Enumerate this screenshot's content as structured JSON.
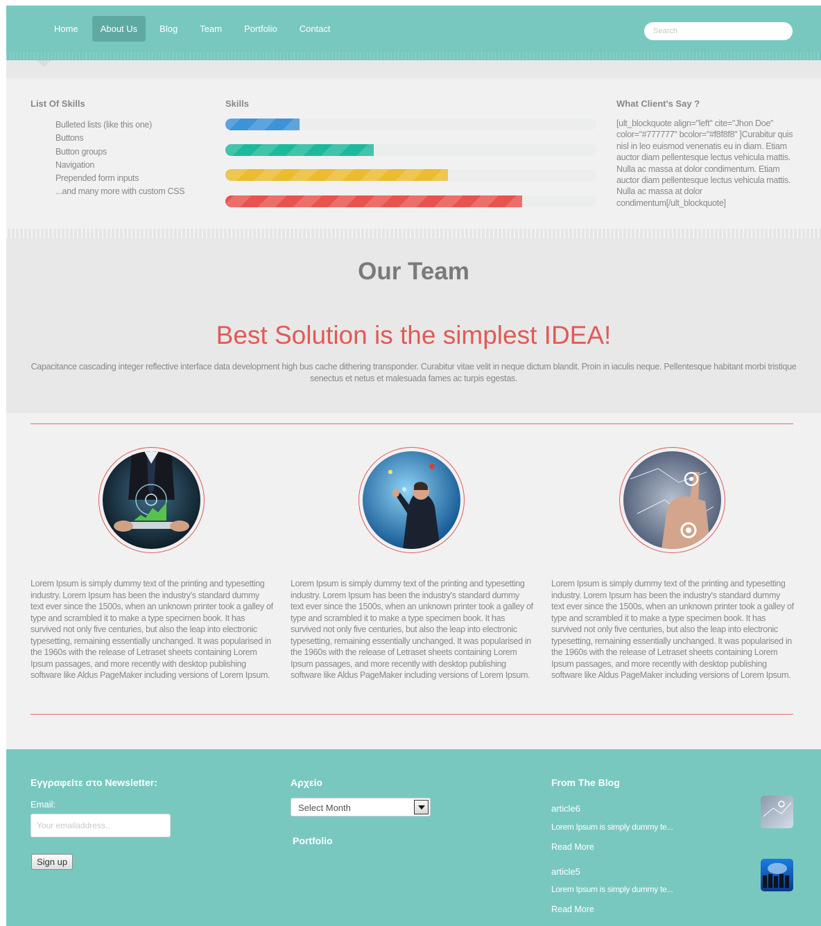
{
  "nav": {
    "items": [
      {
        "label": "Home",
        "active": false
      },
      {
        "label": "About Us",
        "active": true
      },
      {
        "label": "Blog",
        "active": false
      },
      {
        "label": "Team",
        "active": false
      },
      {
        "label": "Portfolio",
        "active": false
      },
      {
        "label": "Contact",
        "active": false
      }
    ],
    "search_placeholder": "Search"
  },
  "skills_list": {
    "heading": "List Of Skills",
    "items": [
      "Bulleted lists (like this one)",
      "Buttons",
      "Button groups",
      "Navigation",
      "Prepended form inputs",
      "...and many more with custom CSS"
    ]
  },
  "skills": {
    "heading": "Skills",
    "bars": [
      {
        "level": 0.2,
        "color": "#3c93d8"
      },
      {
        "level": 0.4,
        "color": "#1db99a"
      },
      {
        "level": 0.6,
        "color": "#ebbc2f"
      },
      {
        "level": 0.8,
        "color": "#e8534e"
      }
    ]
  },
  "clients": {
    "heading": "What Client's Say ?",
    "quote": "[ult_blockquote align=\"left\" cite=\"Jhon Doe\" color=\"#777777\" bcolor=\"#f8f8f8\" ]Curabitur quis nisl in leo euismod venenatis eu in diam. Etiam auctor diam pellentesque lectus vehicula mattis. Nulla ac massa at dolor condimentum. Etiam auctor diam pellentesque lectus vehicula mattis. Nulla ac massa at dolor condimentum[/ult_blockquote]"
  },
  "team": {
    "title": "Our Team",
    "headline": "Best Solution is the simplest IDEA!",
    "description": "Capacitance cascading integer reflective interface data development high bus cache dithering transponder. Curabitur vitae velit in neque dictum blandit. Proin in iaculis neque. Pellentesque habitant morbi tristique senectus et netus et malesuada fames ac turpis egestas.",
    "members": [
      {
        "bio": "Lorem Ipsum is simply dummy text of the printing and typesetting industry. Lorem Ipsum has been the industry's standard dummy text ever since the 1500s, when an unknown printer took a galley of type and scrambled it to make a type specimen book. It has survived not only five centuries, but also the leap into electronic typesetting, remaining essentially unchanged. It was popularised in the 1960s with the release of Letraset sheets containing Lorem Ipsum passages, and more recently with desktop publishing software like Aldus PageMaker including versions of Lorem Ipsum."
      },
      {
        "bio": "Lorem Ipsum is simply dummy text of the printing and typesetting industry. Lorem Ipsum has been the industry's standard dummy text ever since the 1500s, when an unknown printer took a galley of type and scrambled it to make a type specimen book. It has survived not only five centuries, but also the leap into electronic typesetting, remaining essentially unchanged. It was popularised in the 1960s with the release of Letraset sheets containing Lorem Ipsum passages, and more recently with desktop publishing software like Aldus PageMaker including versions of Lorem Ipsum."
      },
      {
        "bio": "Lorem Ipsum is simply dummy text of the printing and typesetting industry. Lorem Ipsum has been the industry's standard dummy text ever since the 1500s, when an unknown printer took a galley of type and scrambled it to make a type specimen book. It has survived not only five centuries, but also the leap into electronic typesetting, remaining essentially unchanged. It was popularised in the 1960s with the release of Letraset sheets containing Lorem Ipsum passages, and more recently with desktop publishing software like Aldus PageMaker including versions of Lorem Ipsum."
      }
    ]
  },
  "footer": {
    "newsletter": {
      "heading": "Εγγραφείτε στο Newsletter:",
      "email_label": "Email:",
      "email_placeholder": "Your emailaddress..",
      "signup_label": "Sign up"
    },
    "archive": {
      "heading": "Αρχείο",
      "select_label": "Select Month",
      "portfolio_label": "Portfolio"
    },
    "blog": {
      "heading": "From The Blog",
      "articles": [
        {
          "title": "article6",
          "excerpt": "Lorem Ipsum is simply dummy te...",
          "read_more": "Read More"
        },
        {
          "title": "article5",
          "excerpt": "Lorem Ipsum is simply dummy te...",
          "read_more": "Read More"
        }
      ]
    }
  }
}
